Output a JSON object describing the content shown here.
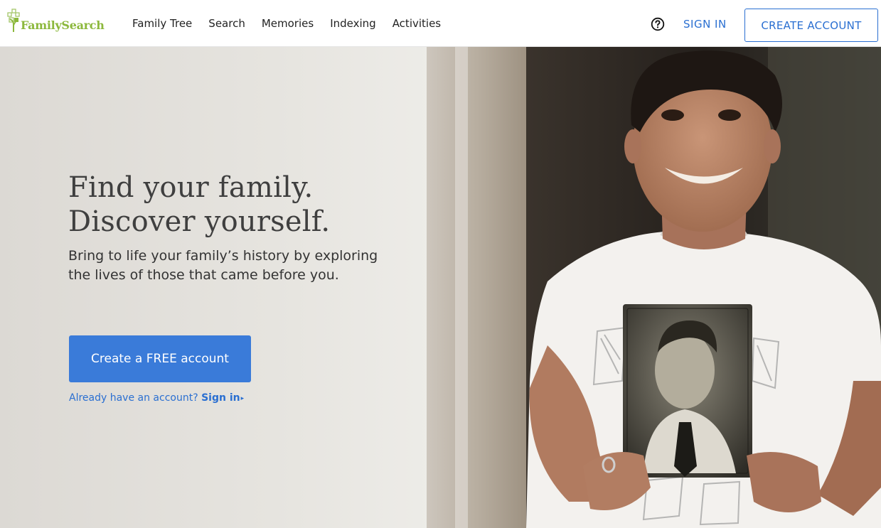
{
  "header": {
    "logo_text": "FamilySearch",
    "nav": [
      {
        "label": "Family Tree"
      },
      {
        "label": "Search"
      },
      {
        "label": "Memories"
      },
      {
        "label": "Indexing"
      },
      {
        "label": "Activities"
      }
    ],
    "help_icon": "question-circle-icon",
    "sign_in": "SIGN IN",
    "create_account": "CREATE ACCOUNT"
  },
  "hero": {
    "headline_line1": "Find your family.",
    "headline_line2": "Discover yourself.",
    "subhead": "Bring to life your family’s history by exploring the lives of those that came before you.",
    "cta": "Create a FREE account",
    "already_text": "Already have an account?",
    "sign_in_link": "Sign in",
    "caret": "▸"
  },
  "colors": {
    "brand_green": "#8cb83c",
    "link_blue": "#2a6fd1",
    "cta_blue": "#3a7bd9",
    "headline": "#3f3f3f"
  }
}
